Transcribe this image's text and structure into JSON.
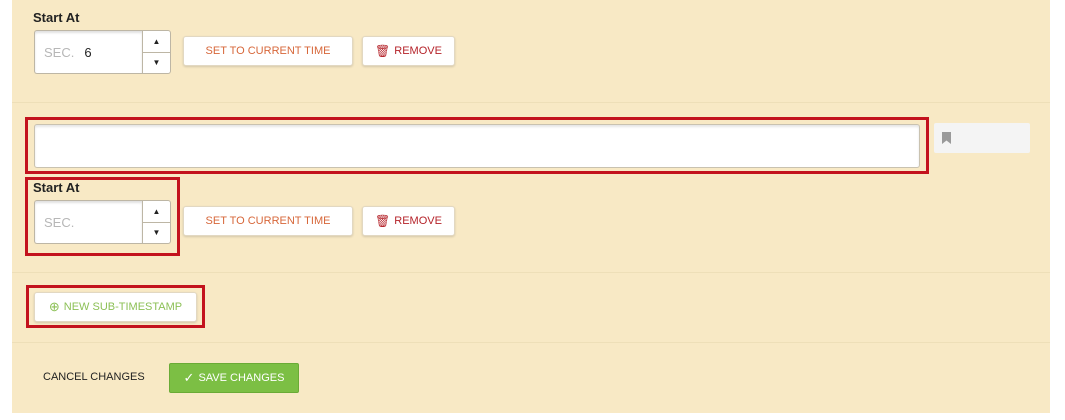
{
  "timestamp1": {
    "start_label": "Start At",
    "seconds_placeholder": "SEC.",
    "seconds_value": "6",
    "set_label": "SET TO CURRENT TIME",
    "remove_label": "REMOVE"
  },
  "timestamp2": {
    "text_value": "",
    "start_label": "Start At",
    "seconds_placeholder": "SEC.",
    "seconds_value": "",
    "set_label": "SET TO CURRENT TIME",
    "remove_label": "REMOVE"
  },
  "new_sub_label": "NEW SUB-TIMESTAMP",
  "footer": {
    "cancel_label": "CANCEL CHANGES",
    "save_label": "SAVE CHANGES"
  },
  "icons": {
    "spin_up": "▲",
    "spin_down": "▼",
    "trash": "🗑",
    "plus_circle": "⊕",
    "check": "✓",
    "bookmark": "bookmark-icon"
  },
  "colors": {
    "panel_bg": "#f8e9c5",
    "highlight": "#c3121d",
    "set_text": "#d7673a",
    "remove_text": "#b5232a",
    "new_text": "#8cc056",
    "save_bg": "#7cbf44"
  }
}
